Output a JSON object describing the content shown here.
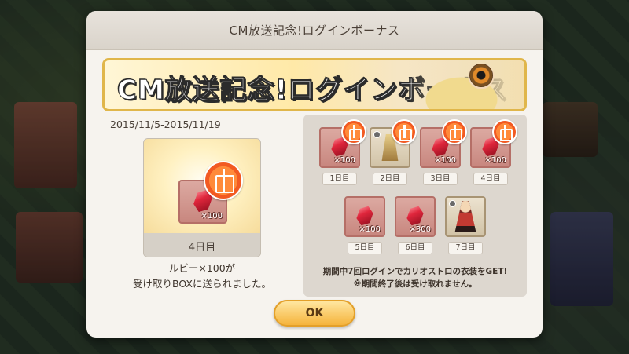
{
  "dialog": {
    "title": "CM放送記念!ログインボーナス",
    "banner_text": "CM放送記念!ログインボーナス",
    "period": "2015/11/5-2015/11/19"
  },
  "today": {
    "item_quantity": "×100",
    "day_label": "4日目",
    "message_line1": "ルビー×100が",
    "message_line2": "受け取りBOXに送られました。"
  },
  "calendar": {
    "days": [
      {
        "label": "1日目",
        "item": "ruby-icon",
        "quantity": "×100",
        "received": true
      },
      {
        "label": "2日目",
        "item": "cloak-icon",
        "quantity": "",
        "received": true
      },
      {
        "label": "3日目",
        "item": "ruby-icon",
        "quantity": "×100",
        "received": true
      },
      {
        "label": "4日目",
        "item": "ruby-icon",
        "quantity": "×100",
        "received": true
      },
      {
        "label": "5日目",
        "item": "ruby-icon",
        "quantity": "×100",
        "received": false
      },
      {
        "label": "6日目",
        "item": "ruby-icon",
        "quantity": "×300",
        "received": false
      },
      {
        "label": "7日目",
        "item": "outfit-icon",
        "quantity": "",
        "received": false
      }
    ],
    "note_line1": "期間中7回ログインでカリオストロの衣装をGET!",
    "note_line2": "※期間終了後は受け取れません。"
  },
  "ok_label": "OK",
  "colors": {
    "accent": "#f5b43c",
    "badge": "#f25a22",
    "ruby": "#e0263c"
  }
}
